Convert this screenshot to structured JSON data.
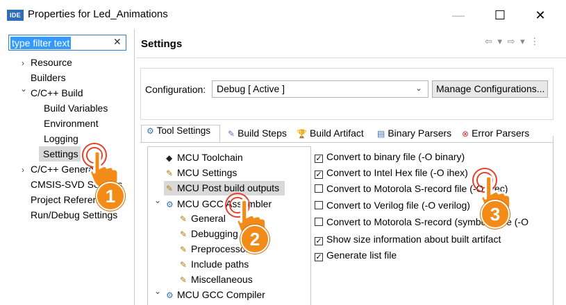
{
  "window": {
    "icon_text": "IDE",
    "title": "Properties for Led_Animations",
    "min_glyph": "—",
    "max_glyph": "☐",
    "close_glyph": "✕"
  },
  "filter": {
    "text": "type filter text",
    "clear_glyph": "✕"
  },
  "tree": {
    "items": [
      {
        "label": "Resource",
        "arrow": "›"
      },
      {
        "label": "Builders"
      },
      {
        "label": "C/C++ Build",
        "arrow": "⌄"
      },
      {
        "label": "Build Variables"
      },
      {
        "label": "Environment"
      },
      {
        "label": "Logging"
      },
      {
        "label": "Settings",
        "selected": true
      },
      {
        "label": "C/C++ General",
        "arrow": "›"
      },
      {
        "label": "CMSIS-SVD Settings"
      },
      {
        "label": "Project References"
      },
      {
        "label": "Run/Debug Settings"
      }
    ]
  },
  "settings": {
    "title": "Settings",
    "nav": "⇦ ▾ ⇨ ▾ ⋮",
    "config_label": "Configuration:",
    "config_value": "Debug  [ Active ]",
    "manage_button": "Manage Configurations..."
  },
  "tabs": [
    {
      "label": "Tool Settings",
      "icon": "⚙",
      "active": true
    },
    {
      "label": "Build Steps",
      "icon": "✎"
    },
    {
      "label": "Build Artifact",
      "icon": "🏆"
    },
    {
      "label": "Binary Parsers",
      "icon": "▤"
    },
    {
      "label": "Error Parsers",
      "icon": "⊗"
    }
  ],
  "tool_tree": [
    {
      "label": "MCU Toolchain",
      "icon": "◆"
    },
    {
      "label": "MCU Settings",
      "icon": "✎"
    },
    {
      "label": "MCU Post build outputs",
      "icon": "✎",
      "selected": true
    },
    {
      "label": "MCU GCC Assembler",
      "icon": "⚙",
      "arrow": "⌄"
    },
    {
      "label": "General",
      "icon": "✎"
    },
    {
      "label": "Debugging",
      "icon": "✎"
    },
    {
      "label": "Preprocessor",
      "icon": "✎"
    },
    {
      "label": "Include paths",
      "icon": "✎"
    },
    {
      "label": "Miscellaneous",
      "icon": "✎"
    },
    {
      "label": "MCU GCC Compiler",
      "icon": "⚙",
      "arrow": "⌄"
    }
  ],
  "options": [
    {
      "label": "Convert to binary file (-O binary)",
      "checked": true
    },
    {
      "label": "Convert to Intel Hex file (-O ihex)",
      "checked": true
    },
    {
      "label": "Convert to Motorola S-record file (-O srec)",
      "checked": false
    },
    {
      "label": "Convert to Verilog file (-O verilog)",
      "checked": false
    },
    {
      "label": "Convert to Motorola S-record (symbols) file (-O",
      "checked": false
    },
    {
      "label": "Show size information about built artifact",
      "checked": true
    },
    {
      "label": "Generate list file",
      "checked": true
    }
  ],
  "markers": [
    "1",
    "2",
    "3"
  ],
  "colors": {
    "selection_bg": "#d9d9d9",
    "filter_highlight": "#3399ff",
    "marker_fill": "#f28b18",
    "ring": "#e2412c"
  }
}
